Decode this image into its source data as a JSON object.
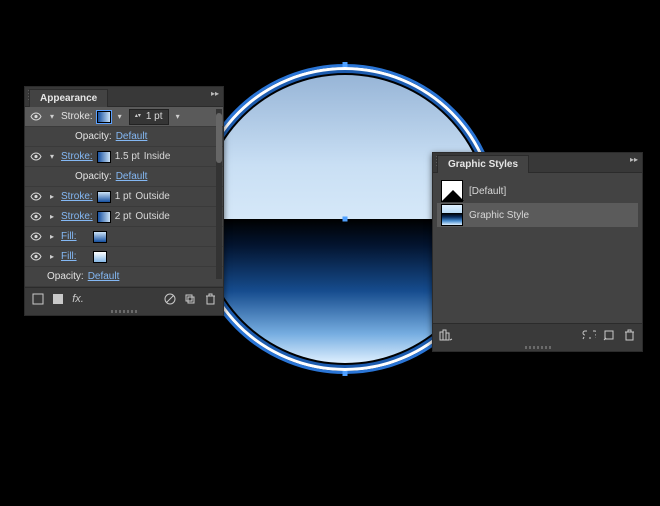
{
  "appearance": {
    "title": "Appearance",
    "rows": {
      "stroke0": {
        "label": "Stroke:",
        "weight": "1 pt",
        "expanded": true,
        "selected": true
      },
      "opacity0": {
        "label": "Opacity:",
        "value": "Default"
      },
      "stroke1": {
        "label": "Stroke:",
        "weight": "1.5 pt",
        "align": "Inside",
        "expanded": true
      },
      "opacity1": {
        "label": "Opacity:",
        "value": "Default"
      },
      "stroke2": {
        "label": "Stroke:",
        "weight": "1 pt",
        "align": "Outside",
        "expanded": false
      },
      "stroke3": {
        "label": "Stroke:",
        "weight": "2 pt",
        "align": "Outside",
        "expanded": false
      },
      "fill0": {
        "label": "Fill:"
      },
      "fill1": {
        "label": "Fill:"
      },
      "opacity2": {
        "label": "Opacity:",
        "value": "Default"
      }
    },
    "footer": {
      "fx": "fx."
    }
  },
  "graphicStyles": {
    "title": "Graphic Styles",
    "items": [
      {
        "name": "[Default]",
        "selected": false
      },
      {
        "name": "Graphic Style",
        "selected": true
      }
    ]
  }
}
